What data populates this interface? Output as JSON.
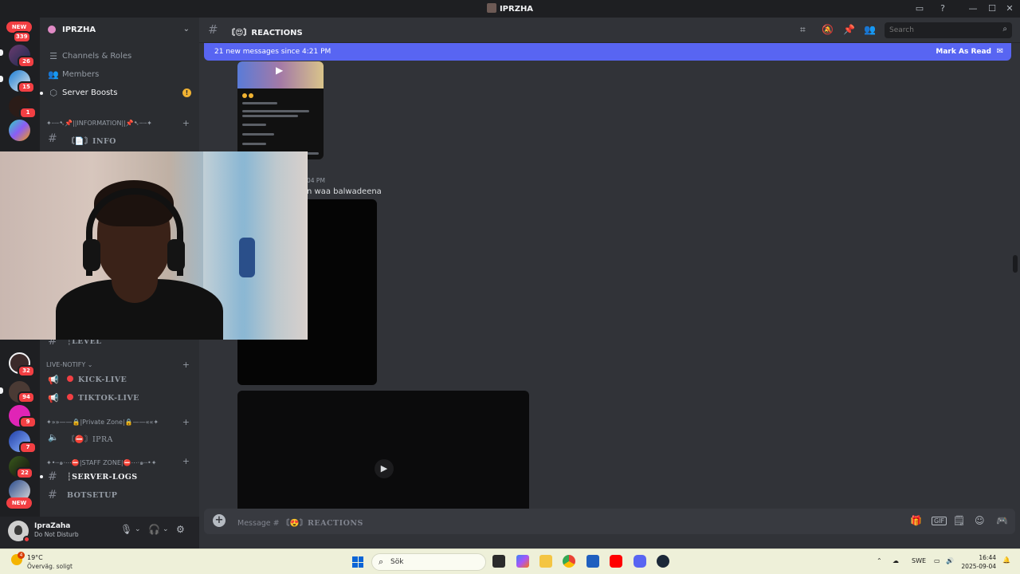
{
  "window": {
    "title": "IPRZHA",
    "controls": {
      "minimize": "—",
      "maximize": "☐",
      "close": "✕"
    }
  },
  "rail": {
    "new_label_top": "NEW",
    "new_label_bottom": "NEW",
    "top_count": "339",
    "badges": [
      "26",
      "15",
      "1",
      "32",
      "94",
      "9",
      "7",
      "22"
    ]
  },
  "sidebar": {
    "server_name": "IPRZHA",
    "nav": [
      {
        "label": "Channels & Roles",
        "icon": "list-icon"
      },
      {
        "label": "Members",
        "icon": "members-icon"
      },
      {
        "label": "Server Boosts",
        "icon": "boost-icon"
      }
    ],
    "boost_alert": "!",
    "categories": {
      "information": "✦┈┈➷📌||INFORMATION||📌➷┈┈✦",
      "live_notify": "LIVE-NOTIFY",
      "private_zone": "✦»»——🔒|Private Zone|🔒——««✦",
      "staff_zone": "✦•┈๑⋅⋯⛔|STAFF ZONE|⛔⋯⋅๑┈•✦"
    },
    "channels": {
      "info": "〘📄〙INFO",
      "level": "┆LEVEL",
      "kick_live": "KICK-LIVE",
      "tiktok_live": "TIKTOK-LIVE",
      "ipra": "〘⛔〙IPRA",
      "server_logs": "┆SERVER-LOGS",
      "botsetup": "BOTSETUP"
    }
  },
  "user": {
    "name": "IpraZaha",
    "status": "Do Not Disturb"
  },
  "channel": {
    "name": "〘😍〙REACTIONS",
    "search_placeholder": "Search"
  },
  "new_messages": {
    "text": "21 new messages since 4:21 PM",
    "mark_read": "Mark As Read"
  },
  "messages": {
    "time_fragment": "04 PM",
    "text_fragment": "n waa balwadeena"
  },
  "composer": {
    "placeholder_prefix": "Message #",
    "placeholder_channel": "〘😍〙REACTIONS"
  },
  "taskbar": {
    "weather_badge": "4",
    "temperature": "19°C",
    "condition": "Överväg. soligt",
    "search_label": "Sök",
    "language": "SWE",
    "time": "16:44",
    "date": "2025-09-04"
  }
}
